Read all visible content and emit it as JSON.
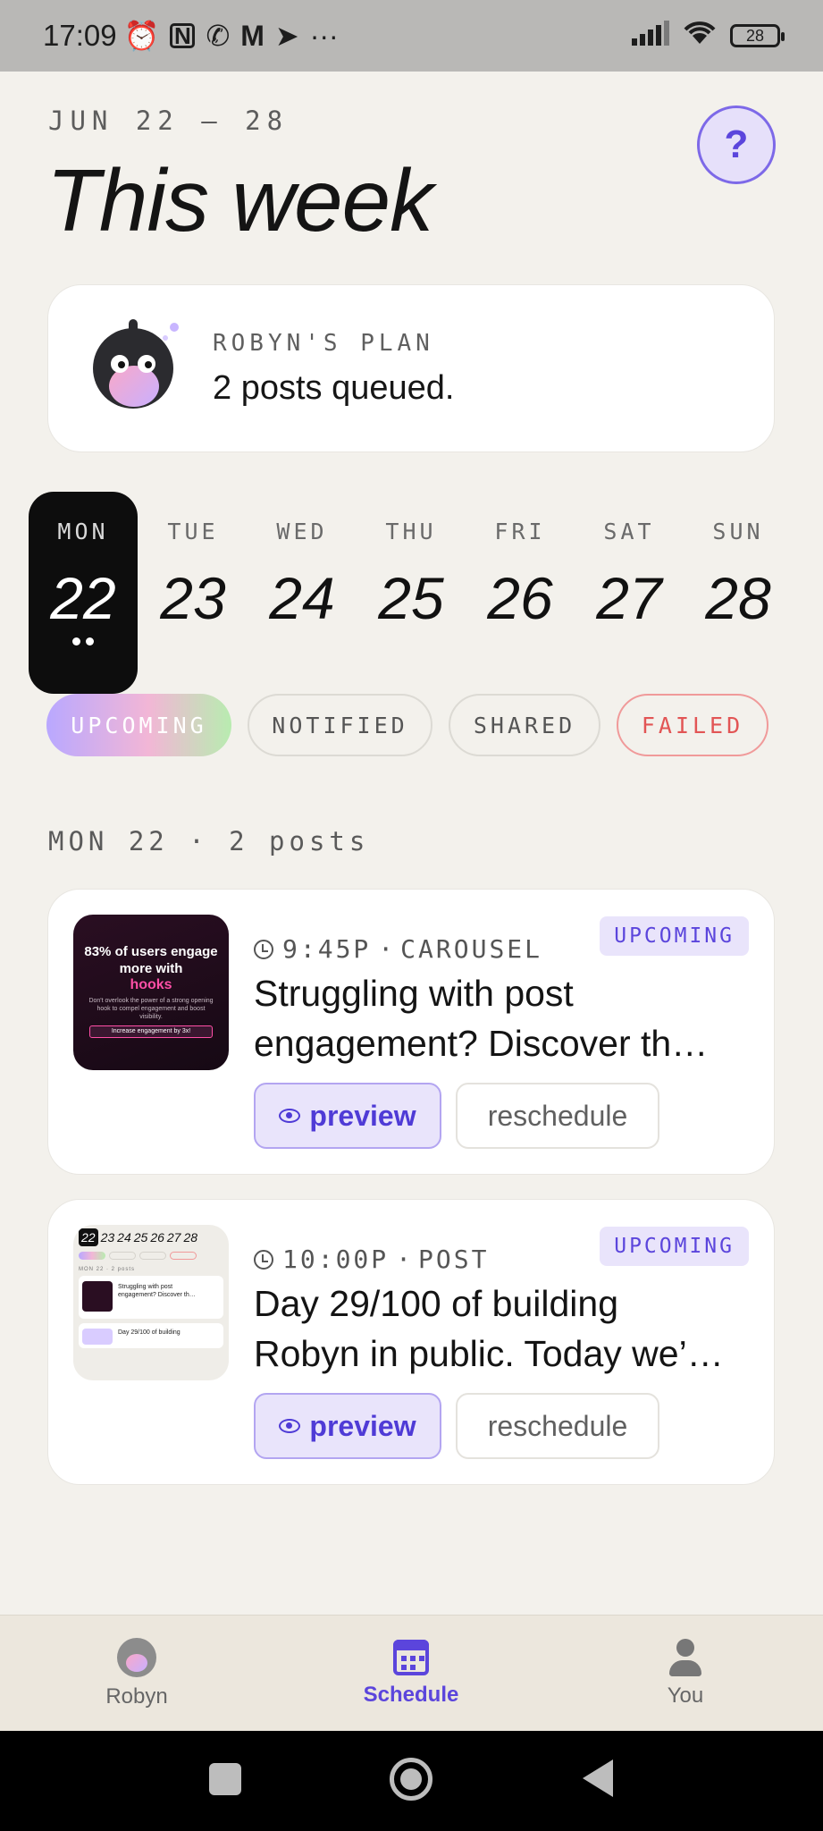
{
  "status_bar": {
    "time": "17:09",
    "more": "···",
    "battery": "28"
  },
  "header": {
    "date_range": "JUN 22 — 28",
    "title": "This week",
    "help": "?"
  },
  "plan": {
    "label": "ROBYN'S PLAN",
    "text": "2 posts queued."
  },
  "days": [
    {
      "name": "MON",
      "num": "22",
      "active": true
    },
    {
      "name": "TUE",
      "num": "23"
    },
    {
      "name": "WED",
      "num": "24"
    },
    {
      "name": "THU",
      "num": "25"
    },
    {
      "name": "FRI",
      "num": "26"
    },
    {
      "name": "SAT",
      "num": "27"
    },
    {
      "name": "SUN",
      "num": "28"
    }
  ],
  "filters": [
    "UPCOMING",
    "NOTIFIED",
    "SHARED",
    "FAILED"
  ],
  "section_label": "MON 22 · 2 posts",
  "posts": [
    {
      "time": "9:45P",
      "type": "CAROUSEL",
      "status": "UPCOMING",
      "text_line1": "Struggling with post",
      "text_line2": "engagement? Discover th…",
      "thumb": {
        "headline": "83% of users engage more with",
        "highlight": "hooks",
        "body": "Don't overlook the power of a strong opening hook to compel engagement and boost visibility.",
        "cta": "Increase engagement by 3x!"
      },
      "preview_label": "preview",
      "reschedule_label": "reschedule"
    },
    {
      "time": "10:00P",
      "type": "POST",
      "status": "UPCOMING",
      "text_line1": "Day 29/100 of building",
      "text_line2": "Robyn in public. Today we’…",
      "thumb": {
        "days": [
          "22",
          "23",
          "24",
          "25",
          "26",
          "27",
          "28"
        ],
        "label": "MON 22 · 2 posts",
        "card1": "Struggling with post engagement? Discover th…",
        "card2": "Day 29/100 of building"
      },
      "preview_label": "preview",
      "reschedule_label": "reschedule"
    }
  ],
  "bottom_nav": [
    {
      "label": "Robyn",
      "icon": "robyn-avatar-icon"
    },
    {
      "label": "Schedule",
      "icon": "calendar-icon",
      "active": true
    },
    {
      "label": "You",
      "icon": "person-icon"
    }
  ],
  "colors": {
    "accent": "#5b45dc",
    "background": "#f3f1ec",
    "failed": "#e25555"
  }
}
